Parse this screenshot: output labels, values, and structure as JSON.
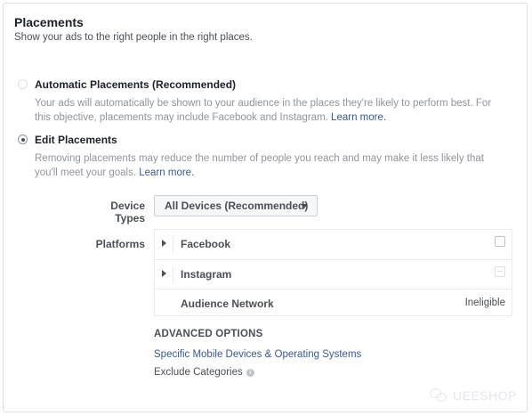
{
  "header": {
    "title": "Placements",
    "subtitle": "Show your ads to the right people in the right places."
  },
  "options": {
    "automatic": {
      "label": "Automatic Placements (Recommended)",
      "description": "Your ads will automatically be shown to your audience in the places they're likely to perform best. For this objective, placements may include Facebook and Instagram.",
      "link": "Learn more."
    },
    "edit": {
      "label": "Edit Placements",
      "description": "Removing placements may reduce the number of people you reach and may make it less likely that you'll meet your goals.",
      "link": "Learn more."
    }
  },
  "device_types": {
    "label": "Device Types",
    "value": "All Devices (Recommended)"
  },
  "platforms": {
    "label": "Platforms",
    "items": [
      {
        "name": "Facebook"
      },
      {
        "name": "Instagram"
      },
      {
        "name": "Audience Network",
        "status": "Ineligible"
      }
    ]
  },
  "advanced": {
    "title": "ADVANCED OPTIONS",
    "link": "Specific Mobile Devices & Operating Systems",
    "exclude": "Exclude Categories",
    "info_icon": "i"
  },
  "watermark": {
    "text": "UEESHOP"
  },
  "colors": {
    "link": "#365899",
    "muted": "#90949c",
    "border": "#dddfe2"
  }
}
